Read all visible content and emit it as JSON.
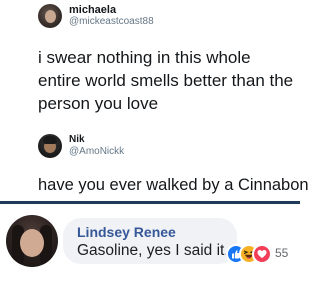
{
  "tweets": [
    {
      "name": "michaela",
      "handle": "@mickeastcoast88",
      "text": "i swear nothing in this whole entire world smells better than the person you love"
    },
    {
      "name": "Nik",
      "handle": "@AmoNickk",
      "text": "have you ever walked by a Cinnabon"
    }
  ],
  "comment": {
    "author": "Lindsey Renee",
    "text": "Gasoline, yes I said it.",
    "reactions": [
      "like-icon",
      "haha-icon",
      "love-icon"
    ],
    "reaction_count": "55"
  },
  "colors": {
    "divider": "#1e3b5a",
    "author_link": "#365899",
    "bubble": "#f0f2f5",
    "like": "#1877f2",
    "haha": "#f7b125",
    "love": "#f33e58"
  }
}
